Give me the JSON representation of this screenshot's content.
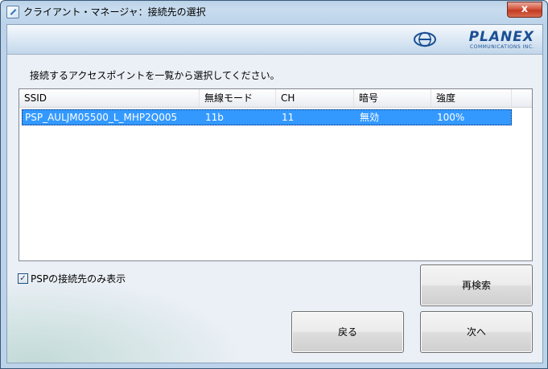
{
  "window": {
    "title": "クライアント・マネージャ：接続先の選択",
    "close_label": "x"
  },
  "brand": {
    "name": "PLANEX",
    "sub": "COMMUNICATIONS INC."
  },
  "instruction": "接続するアクセスポイントを一覧から選択してください。",
  "list": {
    "columns": [
      "SSID",
      "無線モード",
      "CH",
      "暗号",
      "強度"
    ],
    "rows": [
      [
        "PSP_AULJM05500_L_MHP2Q005",
        "11b",
        "11",
        "無効",
        "100%"
      ]
    ],
    "selected_row": 0
  },
  "filter": {
    "label": "PSPの接続先のみ表示",
    "checked": true
  },
  "buttons": {
    "rescan": "再検索",
    "back": "戻る",
    "next": "次へ"
  }
}
